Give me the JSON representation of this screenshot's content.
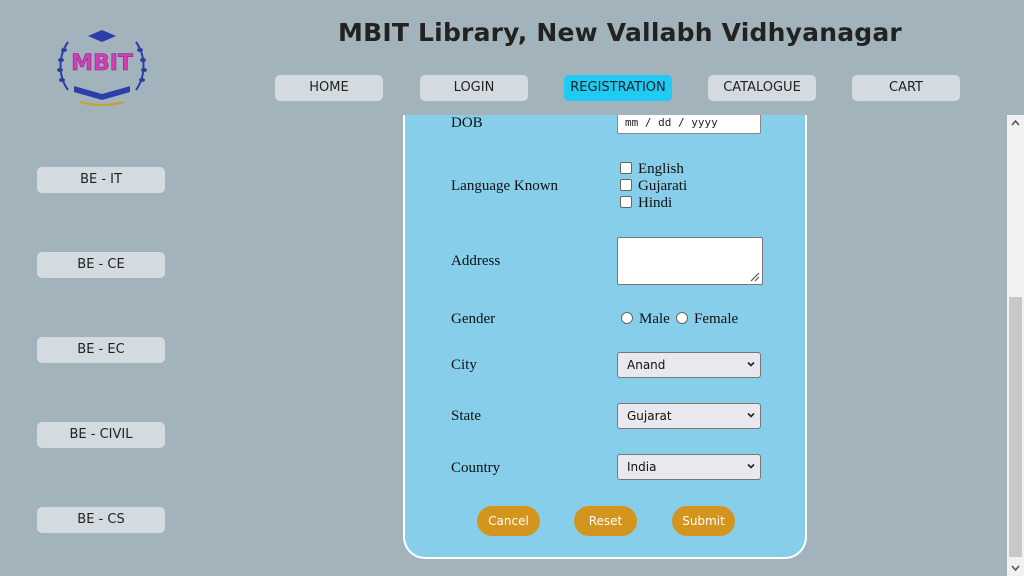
{
  "header": {
    "logo_text": "MBIT",
    "title": "MBIT Library, New Vallabh Vidhyanagar"
  },
  "nav": [
    {
      "label": "HOME",
      "active": false
    },
    {
      "label": "LOGIN",
      "active": false
    },
    {
      "label": "REGISTRATION",
      "active": true
    },
    {
      "label": "CATALOGUE",
      "active": false
    },
    {
      "label": "CART",
      "active": false
    }
  ],
  "sidebar": [
    {
      "label": "BE - IT"
    },
    {
      "label": "BE - CE"
    },
    {
      "label": "BE - EC"
    },
    {
      "label": "BE - CIVIL"
    },
    {
      "label": "BE - CS"
    }
  ],
  "form": {
    "dob": {
      "label": "DOB",
      "placeholder": "mm / dd / yyyy"
    },
    "language": {
      "label": "Language Known",
      "options": [
        "English",
        "Gujarati",
        "Hindi"
      ]
    },
    "address": {
      "label": "Address",
      "value": ""
    },
    "gender": {
      "label": "Gender",
      "options": [
        "Male",
        "Female"
      ]
    },
    "city": {
      "label": "City",
      "value": "Anand"
    },
    "state": {
      "label": "State",
      "value": "Gujarat"
    },
    "country": {
      "label": "Country",
      "value": "India"
    },
    "buttons": {
      "cancel": "Cancel",
      "reset": "Reset",
      "submit": "Submit"
    }
  },
  "colors": {
    "page_bg": "#a3b3bb",
    "form_bg": "#87ceeb",
    "active_nav": "#1ecbf2",
    "button_bg": "#d4951f"
  }
}
